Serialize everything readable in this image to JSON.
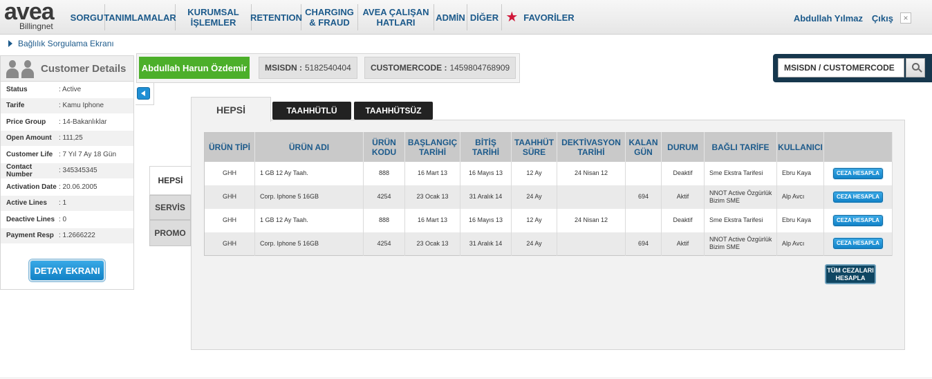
{
  "brand": {
    "name": "avea",
    "sub": "Billingnet"
  },
  "nav": [
    {
      "label": "SORGU",
      "name": "nav-sorgu"
    },
    {
      "label": "TANIMLAMALAR",
      "name": "nav-tanimlamalar"
    },
    {
      "label": "KURUMSAL İŞLEMLER",
      "name": "nav-kurumsal-islemler"
    },
    {
      "label": "RETENTION",
      "name": "nav-retention"
    },
    {
      "label": "CHARGING & FRAUD",
      "name": "nav-charging-fraud"
    },
    {
      "label": "AVEA ÇALIŞAN HATLARI",
      "name": "nav-avea-calisan-hatlari"
    },
    {
      "label": "ADMİN",
      "name": "nav-admin"
    },
    {
      "label": "DİĞER",
      "name": "nav-diger"
    }
  ],
  "favorites_label": "FAVORİLER",
  "user_name": "Abdullah Yılmaz",
  "logout_label": "Çıkış",
  "close_label": "×",
  "breadcrumb": "Bağlılık Sorgulama Ekranı",
  "customer_details_title": "Customer Details",
  "customer_name": "Abdullah Harun Özdemir",
  "msisdn": {
    "label": "MSISDN :",
    "value": "5182540404"
  },
  "customercode": {
    "label": "CUSTOMERCODE :",
    "value": "1459804768909"
  },
  "search_placeholder": "MSISDN / CUSTOMERCODE",
  "details": [
    {
      "key": "Status",
      "value": ": Active"
    },
    {
      "key": "Tarife",
      "value": ": Kamu Iphone"
    },
    {
      "key": "Price Group",
      "value": ": 14-Bakanlıklar"
    },
    {
      "key": "Open Amount",
      "value": ": 111,25"
    },
    {
      "key": "Customer Life",
      "value": ": 7 Yıl 7 Ay 18 Gün"
    },
    {
      "key": "Contact Number",
      "value": ": 345345345"
    },
    {
      "key": "Activation Date",
      "value": ": 20.06.2005"
    },
    {
      "key": "Active Lines",
      "value": ": 1"
    },
    {
      "key": "Deactive Lines",
      "value": ": 0"
    },
    {
      "key": "Payment Resp",
      "value": ": 1.2666222"
    }
  ],
  "detay_button": "DETAY EKRANI",
  "tabs": {
    "hepsi": "HEPSİ",
    "taahhutlu": "TAAHHÜTLÜ",
    "taahhutsuz": "TAAHHÜTSÜZ"
  },
  "vtabs": {
    "hepsi": "HEPSİ",
    "servis": "SERVİS",
    "promo": "PROMO"
  },
  "table": {
    "headers": [
      "ÜRÜN TİPİ",
      "ÜRÜN ADI",
      "ÜRÜN KODU",
      "BAŞLANGIÇ TARİHİ",
      "BİTİŞ TARİHİ",
      "TAAHHÜT SÜRE",
      "DEKTİVASYON TARİHİ",
      "KALAN GÜN",
      "DURUM",
      "BAĞLI TARİFE",
      "KULLANICI",
      ""
    ],
    "rows": [
      [
        "GHH",
        "1 GB 12 Ay Taah.",
        "888",
        "16 Mart 13",
        "16 Mayıs 13",
        "12 Ay",
        "24 Nisan 12",
        "",
        "Deaktif",
        "Sme Ekstra Tarifesi",
        "Ebru Kaya"
      ],
      [
        "GHH",
        "Corp. Iphone 5 16GB",
        "4254",
        "23 Ocak 13",
        "31 Aralık 14",
        "24 Ay",
        "",
        "694",
        "Aktif",
        "NNOT Active Özgürlük Bizim SME",
        "Alp Avcı"
      ],
      [
        "GHH",
        "1 GB 12 Ay Taah.",
        "888",
        "16 Mart 13",
        "16 Mayıs 13",
        "12 Ay",
        "24 Nisan 12",
        "",
        "Deaktif",
        "Sme Ekstra Tarifesi",
        "Ebru Kaya"
      ],
      [
        "GHH",
        "Corp. Iphone 5 16GB",
        "4254",
        "23 Ocak 13",
        "31 Aralık 14",
        "24 Ay",
        "",
        "694",
        "Aktif",
        "NNOT Active Özgürlük Bizim SME",
        "Alp Avcı"
      ]
    ],
    "action_label": "CEZA HESAPLA"
  },
  "tum_button": "TÜM CEZALARI HESAPLA",
  "colors": {
    "nav_text": "#1c5a8b",
    "green": "#4caf2a",
    "button_blue": "#1f8fd4",
    "dark_navy": "#16374d"
  }
}
